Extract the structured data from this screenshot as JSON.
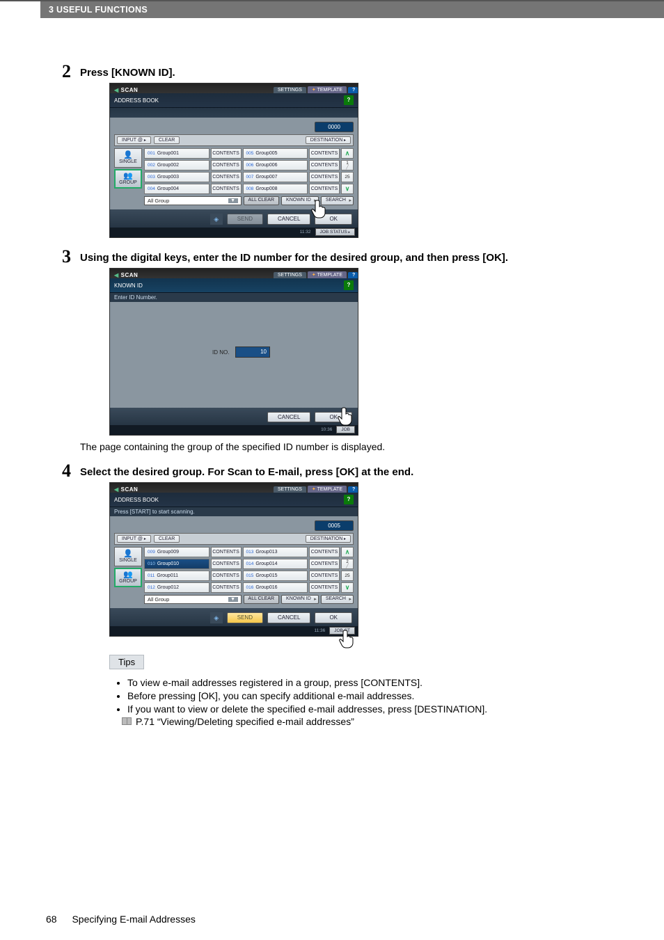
{
  "header": {
    "section": "3 USEFUL FUNCTIONS"
  },
  "steps": {
    "s2": {
      "num": "2",
      "title": "Press [KNOWN ID]."
    },
    "s3": {
      "num": "3",
      "title": "Using the digital keys, enter the ID number for the desired group, and then press [OK].",
      "desc": "The page containing the group of the specified ID number is displayed."
    },
    "s4": {
      "num": "4",
      "title": "Select the desired group. For Scan to E-mail, press [OK] at the end."
    }
  },
  "panel": {
    "top": {
      "title": "SCAN",
      "settings": "SETTINGS",
      "template": "TEMPLATE",
      "help": "?"
    },
    "ab_title": "ADDRESS BOOK",
    "qmark": "?",
    "start_note": "Press [START] to start scanning.",
    "toolbar": {
      "input": "INPUT @",
      "clear": "CLEAR",
      "destination": "DESTINATION"
    },
    "side": {
      "single": "SINGLE",
      "group": "GROUP"
    },
    "contents_label": "CONTENTS",
    "dropdown": "All Group",
    "ctrl": {
      "allclear": "ALL CLEAR",
      "knownid": "KNOWN ID",
      "search": "SEARCH"
    },
    "footer": {
      "send": "SEND",
      "cancel": "CANCEL",
      "ok": "OK"
    },
    "jobstatus": "JOB STATUS",
    "known_id_header": "KNOWN ID",
    "known_id_prompt": "Enter ID Number.",
    "id_label": "ID NO.",
    "id_value": "10"
  },
  "p2": {
    "count": "0000",
    "timestamp_top": "11:32",
    "pager": {
      "top": "1",
      "bottom": "25"
    },
    "rows": [
      {
        "a_idx": "001",
        "a_name": "Group001",
        "b_idx": "005",
        "b_name": "Group005"
      },
      {
        "a_idx": "002",
        "a_name": "Group002",
        "b_idx": "006",
        "b_name": "Group006"
      },
      {
        "a_idx": "003",
        "a_name": "Group003",
        "b_idx": "007",
        "b_name": "Group007"
      },
      {
        "a_idx": "004",
        "a_name": "Group004",
        "b_idx": "008",
        "b_name": "Group008"
      }
    ]
  },
  "p3": {
    "timestamp": "10:36",
    "jobstatus_short": "JOB"
  },
  "p4": {
    "count": "0005",
    "timestamp": "11:36",
    "pager": {
      "top": "2",
      "bottom": "25"
    },
    "jobstatus_short": "JOB ST",
    "rows": [
      {
        "a_idx": "009",
        "a_name": "Group009",
        "b_idx": "013",
        "b_name": "Group013",
        "sel": false
      },
      {
        "a_idx": "010",
        "a_name": "Group010",
        "b_idx": "014",
        "b_name": "Group014",
        "sel": true
      },
      {
        "a_idx": "011",
        "a_name": "Group011",
        "b_idx": "015",
        "b_name": "Group015",
        "sel": false
      },
      {
        "a_idx": "012",
        "a_name": "Group012",
        "b_idx": "016",
        "b_name": "Group016",
        "sel": false
      }
    ]
  },
  "tips": {
    "label": "Tips",
    "b1": "To view e-mail addresses registered in a group, press [CONTENTS].",
    "b2": "Before pressing [OK], you can specify additional e-mail addresses.",
    "b3": "If you want to view or delete the specified e-mail addresses, press [DESTINATION].",
    "ref": "P.71 “Viewing/Deleting specified e-mail addresses”"
  },
  "footer": {
    "page": "68",
    "title": "Specifying E-mail Addresses"
  }
}
